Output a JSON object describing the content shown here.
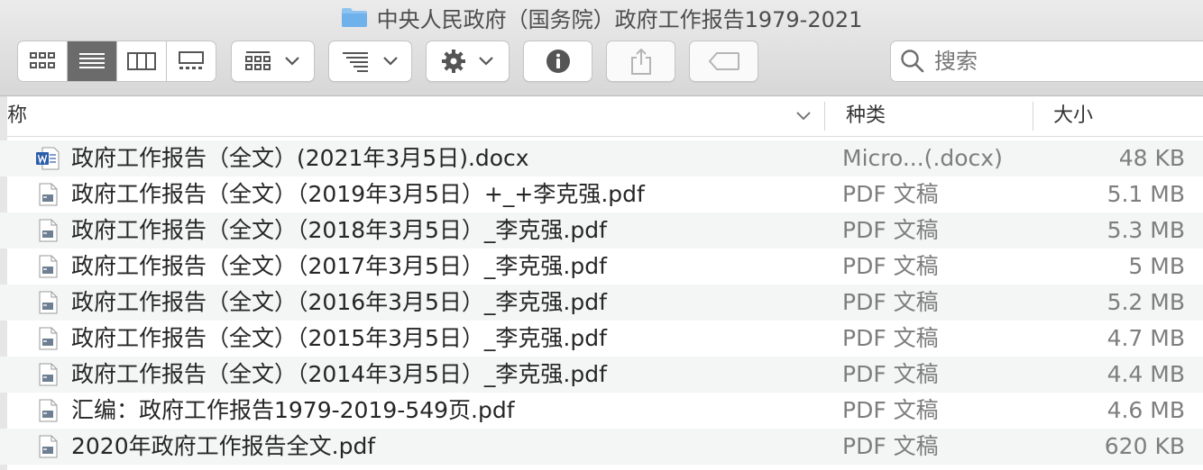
{
  "window": {
    "title": "中央人民政府（国务院）政府工作报告1979-2021",
    "title_icon": "folder-icon"
  },
  "toolbar": {
    "view_modes": [
      {
        "name": "icon-view",
        "icon": "grid-icon",
        "active": false
      },
      {
        "name": "list-view",
        "icon": "list-icon",
        "active": true
      },
      {
        "name": "column-view",
        "icon": "columns-icon",
        "active": false
      },
      {
        "name": "gallery-view",
        "icon": "gallery-icon",
        "active": false
      }
    ],
    "group_icon": "group-by-icon",
    "arrange_icon": "arrange-icon",
    "action_icon": "gear-icon",
    "info_icon": "info-icon",
    "share_icon": "share-icon",
    "tag_icon": "tag-icon",
    "search_placeholder": "搜索"
  },
  "columns": {
    "name": "名称",
    "kind": "种类",
    "size": "大小"
  },
  "files": [
    {
      "name": "政府工作报告（全文）(2021年3月5日).docx",
      "kind": "Micro...(.docx)",
      "size": "48 KB",
      "icon": "word-doc-icon"
    },
    {
      "name": "政府工作报告（全文）（2019年3月5日）+_+李克强.pdf",
      "kind": "PDF 文稿",
      "size": "5.1 MB",
      "icon": "pdf-icon"
    },
    {
      "name": "政府工作报告（全文）（2018年3月5日）_李克强.pdf",
      "kind": "PDF 文稿",
      "size": "5.3 MB",
      "icon": "pdf-icon"
    },
    {
      "name": "政府工作报告（全文）（2017年3月5日）_李克强.pdf",
      "kind": "PDF 文稿",
      "size": "5 MB",
      "icon": "pdf-icon"
    },
    {
      "name": "政府工作报告（全文）（2016年3月5日）_李克强.pdf",
      "kind": "PDF 文稿",
      "size": "5.2 MB",
      "icon": "pdf-icon"
    },
    {
      "name": "政府工作报告（全文）（2015年3月5日）_李克强.pdf",
      "kind": "PDF 文稿",
      "size": "4.7 MB",
      "icon": "pdf-icon"
    },
    {
      "name": "政府工作报告（全文）（2014年3月5日）_李克强.pdf",
      "kind": "PDF 文稿",
      "size": "4.4 MB",
      "icon": "pdf-icon"
    },
    {
      "name": "汇编：政府工作报告1979-2019-549页.pdf",
      "kind": "PDF 文稿",
      "size": "4.6 MB",
      "icon": "pdf-icon"
    },
    {
      "name": "2020年政府工作报告全文.pdf",
      "kind": "PDF 文稿",
      "size": "620 KB",
      "icon": "pdf-icon"
    }
  ]
}
